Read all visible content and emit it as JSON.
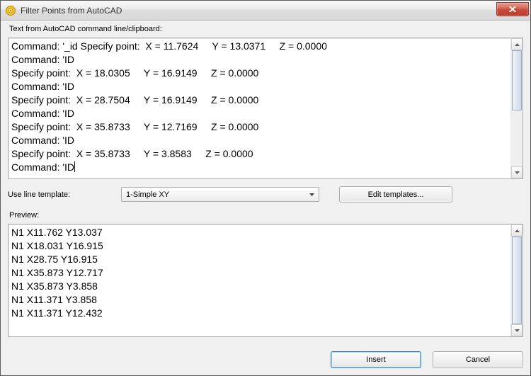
{
  "window": {
    "title": "Filter Points from AutoCAD"
  },
  "labels": {
    "input": "Text from AutoCAD command line/clipboard:",
    "template": "Use line template:",
    "preview": "Preview:"
  },
  "input_text": "Command: '_id Specify point:  X = 11.7624     Y = 13.0371     Z = 0.0000\nCommand: 'ID\nSpecify point:  X = 18.0305     Y = 16.9149     Z = 0.0000\nCommand: 'ID\nSpecify point:  X = 28.7504     Y = 16.9149     Z = 0.0000\nCommand: 'ID\nSpecify point:  X = 35.8733     Y = 12.7169     Z = 0.0000\nCommand: 'ID\nSpecify point:  X = 35.8733     Y = 3.8583     Z = 0.0000\nCommand: 'ID",
  "template": {
    "selected": "1-Simple XY",
    "edit_button": "Edit templates..."
  },
  "preview_text": "N1 X11.762 Y13.037\nN1 X18.031 Y16.915\nN1 X28.75 Y16.915\nN1 X35.873 Y12.717\nN1 X35.873 Y3.858\nN1 X11.371 Y3.858\nN1 X11.371 Y12.432",
  "buttons": {
    "insert": "Insert",
    "cancel": "Cancel"
  }
}
